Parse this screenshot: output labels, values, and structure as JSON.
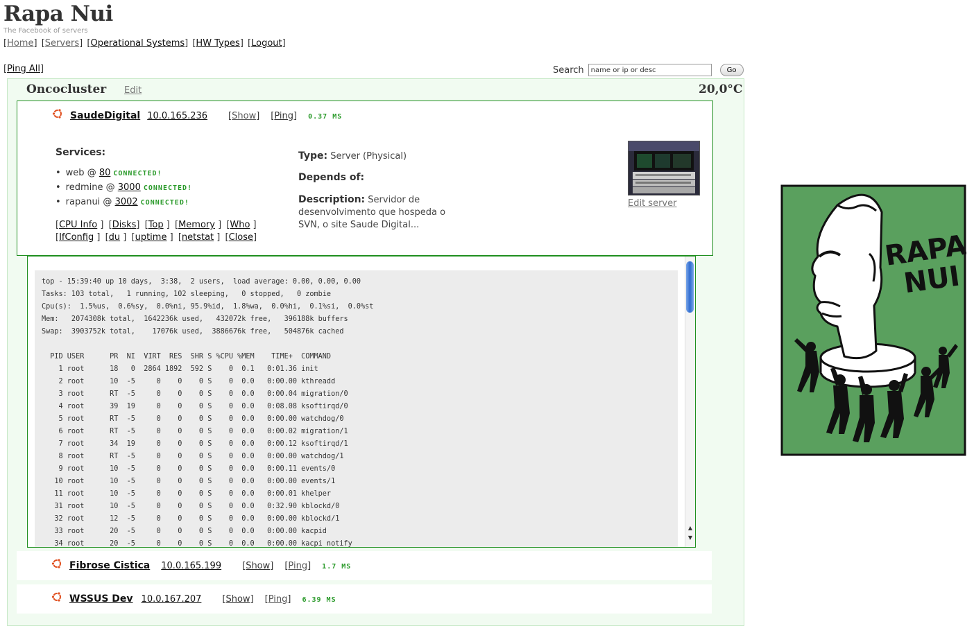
{
  "header": {
    "title": "Rapa Nui",
    "tagline": "The Facebook of servers"
  },
  "nav": [
    {
      "label": "Home"
    },
    {
      "label": "Servers"
    },
    {
      "label": "Operational Systems"
    },
    {
      "label": "HW Types"
    },
    {
      "label": "Logout"
    }
  ],
  "toolbar": {
    "ping_all": "Ping All",
    "search_label": "Search",
    "search_value": "name or ip or desc",
    "go_label": "Go"
  },
  "cluster": {
    "name": "Oncocluster",
    "edit": "Edit",
    "temperature": "20,0°C"
  },
  "servers": [
    {
      "name": "SaudeDigital",
      "ip": "10.0.165.236",
      "show": "Show",
      "ping": "Ping",
      "ping_result": "0.37 MS",
      "services_title": "Services:",
      "services": [
        {
          "name": "web",
          "port": "80",
          "status": "CONNECTED!"
        },
        {
          "name": "redmine",
          "port": "3000",
          "status": "CONNECTED!"
        },
        {
          "name": "rapanui",
          "port": "3002",
          "status": "CONNECTED!"
        }
      ],
      "tools": [
        "CPU Info",
        "Disks",
        "Top",
        "Memory",
        "Who",
        "IfConfig",
        "du",
        "uptime",
        "netstat",
        "Close"
      ],
      "type_label": "Type:",
      "type_value": "Server (Physical)",
      "depends_label": "Depends of:",
      "description_label": "Description:",
      "description_value": "Servidor de desenvolvimento que hospeda o SVN, o site Saude Digital...",
      "edit_server": "Edit server",
      "console_output": "top - 15:39:40 up 10 days,  3:38,  2 users,  load average: 0.00, 0.00, 0.00\nTasks: 103 total,   1 running, 102 sleeping,   0 stopped,   0 zombie\nCpu(s):  1.5%us,  0.6%sy,  0.0%ni, 95.9%id,  1.8%wa,  0.0%hi,  0.1%si,  0.0%st\nMem:   2074308k total,  1642236k used,   432072k free,   396188k buffers\nSwap:  3903752k total,    17076k used,  3886676k free,   504876k cached\n\n  PID USER      PR  NI  VIRT  RES  SHR S %CPU %MEM    TIME+  COMMAND\n    1 root      18   0  2864 1892  592 S    0  0.1   0:01.36 init\n    2 root      10  -5     0    0    0 S    0  0.0   0:00.00 kthreadd\n    3 root      RT  -5     0    0    0 S    0  0.0   0:00.04 migration/0\n    4 root      39  19     0    0    0 S    0  0.0   0:08.08 ksoftirqd/0\n    5 root      RT  -5     0    0    0 S    0  0.0   0:00.00 watchdog/0\n    6 root      RT  -5     0    0    0 S    0  0.0   0:00.02 migration/1\n    7 root      34  19     0    0    0 S    0  0.0   0:00.12 ksoftirqd/1\n    8 root      RT  -5     0    0    0 S    0  0.0   0:00.00 watchdog/1\n    9 root      10  -5     0    0    0 S    0  0.0   0:00.11 events/0\n   10 root      10  -5     0    0    0 S    0  0.0   0:00.00 events/1\n   11 root      10  -5     0    0    0 S    0  0.0   0:00.01 khelper\n   31 root      10  -5     0    0    0 S    0  0.0   0:32.90 kblockd/0\n   32 root      12  -5     0    0    0 S    0  0.0   0:00.00 kblockd/1\n   33 root      20  -5     0    0    0 S    0  0.0   0:00.00 kacpid\n   34 root      20  -5     0    0    0 S    0  0.0   0:00.00 kacpi_notify"
    },
    {
      "name": "Fibrose Cistica",
      "ip": "10.0.165.199",
      "show": "Show",
      "ping": "Ping",
      "ping_result": "1.7 MS"
    },
    {
      "name": "WSSUS Dev",
      "ip": "10.0.167.207",
      "show": "Show",
      "ping": "Ping",
      "ping_result": "6.39 MS"
    }
  ],
  "logo": {
    "text_line1": "RAPA",
    "text_line2": "NUI"
  },
  "colors": {
    "accent_green": "#2a9a2a",
    "border_green": "#1f8f1f",
    "cluster_bg": "#f1fbf1",
    "logo_green": "#5aa05e"
  }
}
